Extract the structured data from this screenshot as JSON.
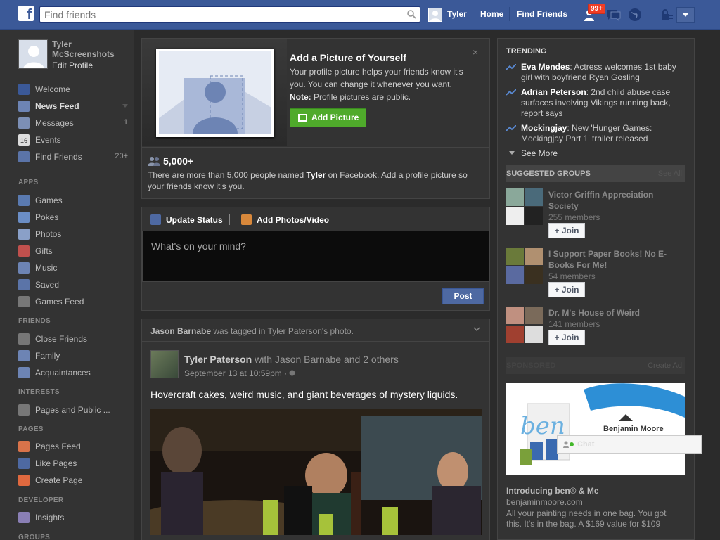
{
  "topbar": {
    "logo": "f",
    "search_placeholder": "Find friends",
    "user_name": "Tyler",
    "home": "Home",
    "find_friends": "Find Friends",
    "notif_count": "99+",
    "bar_color": "#3b5998"
  },
  "profile": {
    "name": "Tyler McScreenshots",
    "edit": "Edit Profile"
  },
  "nav": {
    "favorites": [
      {
        "label": "Welcome",
        "icon": "facebook-icon",
        "count": ""
      },
      {
        "label": "News Feed",
        "icon": "news-feed-icon",
        "count": ""
      },
      {
        "label": "Messages",
        "icon": "messages-icon",
        "count": "1"
      },
      {
        "label": "Events",
        "icon": "calendar-icon",
        "count": ""
      },
      {
        "label": "Find Friends",
        "icon": "find-friends-icon",
        "count": "20+"
      }
    ],
    "apps_title": "APPS",
    "apps": [
      {
        "label": "Games",
        "icon": "games-icon"
      },
      {
        "label": "Pokes",
        "icon": "pokes-icon"
      },
      {
        "label": "Photos",
        "icon": "photos-icon"
      },
      {
        "label": "Gifts",
        "icon": "gifts-icon"
      },
      {
        "label": "Music",
        "icon": "music-icon"
      },
      {
        "label": "Saved",
        "icon": "saved-icon"
      },
      {
        "label": "Games Feed",
        "icon": "games-feed-icon"
      }
    ],
    "friends_title": "FRIENDS",
    "friends": [
      {
        "label": "Close Friends",
        "icon": "star-icon"
      },
      {
        "label": "Family",
        "icon": "family-icon"
      },
      {
        "label": "Acquaintances",
        "icon": "acquaintances-icon"
      }
    ],
    "interests_title": "INTERESTS",
    "interests": [
      {
        "label": "Pages and Public ...",
        "icon": "pages-feed-icon"
      }
    ],
    "pages_title": "PAGES",
    "pages": [
      {
        "label": "Pages Feed",
        "icon": "flag-icon"
      },
      {
        "label": "Like Pages",
        "icon": "thumbs-up-icon"
      },
      {
        "label": "Create Page",
        "icon": "plus-icon"
      }
    ],
    "developer_title": "DEVELOPER",
    "developer": [
      {
        "label": "Insights",
        "icon": "insights-icon"
      }
    ],
    "groups_title": "GROUPS"
  },
  "add_picture": {
    "title": "Add a Picture of Yourself",
    "desc": "Your profile picture helps your friends know it's you. You can change it whenever you want.",
    "note_label": "Note:",
    "note_text": "Profile pictures are public.",
    "button": "Add Picture",
    "close": "×",
    "count": "5,000+",
    "count_desc_before": "There are more than 5,000 people named ",
    "count_name": "Tyler",
    "count_desc_after": " on Facebook. Add a profile picture so your friends know it's you."
  },
  "composer": {
    "tab_status": "Update Status",
    "tab_photos": "Add Photos/Video",
    "placeholder": "What's on your mind?",
    "post": "Post"
  },
  "story": {
    "header_name": "Jason Barnabe",
    "header_rest": " was tagged in Tyler Paterson's photo.",
    "author": "Tyler Paterson",
    "with": " with Jason Barnabe and 2 others",
    "time": "September 13 at 10:59pm · ",
    "text": "Hovercraft cakes, weird music, and giant beverages of mystery liquids."
  },
  "trending": {
    "title": "TRENDING",
    "items": [
      {
        "name": "Eva Mendes",
        "text": ": Actress welcomes 1st baby girl with boyfriend Ryan Gosling"
      },
      {
        "name": "Adrian Peterson",
        "text": ": 2nd child abuse case surfaces involving Vikings running back, report says"
      },
      {
        "name": "Mockingjay",
        "text": ": New 'Hunger Games: Mockingjay Part 1' trailer released"
      }
    ],
    "see_more": "See More"
  },
  "suggested_groups": {
    "title": "SUGGESTED GROUPS",
    "see_all": "See All",
    "join": "+ Join",
    "groups": [
      {
        "name": "Victor Griffin Appreciation Society",
        "members": "255 members"
      },
      {
        "name": "I Support Paper Books! No E-Books For Me!",
        "members": "54 members"
      },
      {
        "name": "Dr. M's House of Weird",
        "members": "141 members"
      }
    ]
  },
  "sponsored": {
    "title": "SPONSORED",
    "create_ad": "Create Ad",
    "brand": "Benjamin Moore",
    "ad_script": "ben",
    "ad_title": "Introducing ben® & Me",
    "ad_url": "benjaminmoore.com",
    "ad_desc": "All your painting needs in one bag. You got this. It's in the bag. A $169 value for $109"
  },
  "chat": {
    "label": "Chat"
  }
}
